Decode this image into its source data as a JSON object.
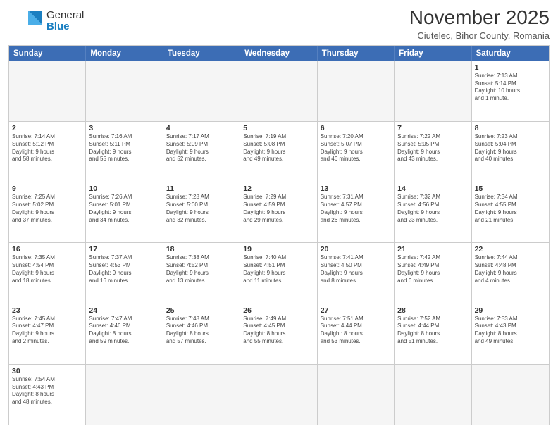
{
  "header": {
    "logo_general": "General",
    "logo_blue": "Blue",
    "month_title": "November 2025",
    "subtitle": "Ciutelec, Bihor County, Romania"
  },
  "day_headers": [
    "Sunday",
    "Monday",
    "Tuesday",
    "Wednesday",
    "Thursday",
    "Friday",
    "Saturday"
  ],
  "rows": [
    [
      {
        "num": "",
        "info": ""
      },
      {
        "num": "",
        "info": ""
      },
      {
        "num": "",
        "info": ""
      },
      {
        "num": "",
        "info": ""
      },
      {
        "num": "",
        "info": ""
      },
      {
        "num": "",
        "info": ""
      },
      {
        "num": "1",
        "info": "Sunrise: 7:13 AM\nSunset: 5:14 PM\nDaylight: 10 hours\nand 1 minute."
      }
    ],
    [
      {
        "num": "2",
        "info": "Sunrise: 7:14 AM\nSunset: 5:12 PM\nDaylight: 9 hours\nand 58 minutes."
      },
      {
        "num": "3",
        "info": "Sunrise: 7:16 AM\nSunset: 5:11 PM\nDaylight: 9 hours\nand 55 minutes."
      },
      {
        "num": "4",
        "info": "Sunrise: 7:17 AM\nSunset: 5:09 PM\nDaylight: 9 hours\nand 52 minutes."
      },
      {
        "num": "5",
        "info": "Sunrise: 7:19 AM\nSunset: 5:08 PM\nDaylight: 9 hours\nand 49 minutes."
      },
      {
        "num": "6",
        "info": "Sunrise: 7:20 AM\nSunset: 5:07 PM\nDaylight: 9 hours\nand 46 minutes."
      },
      {
        "num": "7",
        "info": "Sunrise: 7:22 AM\nSunset: 5:05 PM\nDaylight: 9 hours\nand 43 minutes."
      },
      {
        "num": "8",
        "info": "Sunrise: 7:23 AM\nSunset: 5:04 PM\nDaylight: 9 hours\nand 40 minutes."
      }
    ],
    [
      {
        "num": "9",
        "info": "Sunrise: 7:25 AM\nSunset: 5:02 PM\nDaylight: 9 hours\nand 37 minutes."
      },
      {
        "num": "10",
        "info": "Sunrise: 7:26 AM\nSunset: 5:01 PM\nDaylight: 9 hours\nand 34 minutes."
      },
      {
        "num": "11",
        "info": "Sunrise: 7:28 AM\nSunset: 5:00 PM\nDaylight: 9 hours\nand 32 minutes."
      },
      {
        "num": "12",
        "info": "Sunrise: 7:29 AM\nSunset: 4:59 PM\nDaylight: 9 hours\nand 29 minutes."
      },
      {
        "num": "13",
        "info": "Sunrise: 7:31 AM\nSunset: 4:57 PM\nDaylight: 9 hours\nand 26 minutes."
      },
      {
        "num": "14",
        "info": "Sunrise: 7:32 AM\nSunset: 4:56 PM\nDaylight: 9 hours\nand 23 minutes."
      },
      {
        "num": "15",
        "info": "Sunrise: 7:34 AM\nSunset: 4:55 PM\nDaylight: 9 hours\nand 21 minutes."
      }
    ],
    [
      {
        "num": "16",
        "info": "Sunrise: 7:35 AM\nSunset: 4:54 PM\nDaylight: 9 hours\nand 18 minutes."
      },
      {
        "num": "17",
        "info": "Sunrise: 7:37 AM\nSunset: 4:53 PM\nDaylight: 9 hours\nand 16 minutes."
      },
      {
        "num": "18",
        "info": "Sunrise: 7:38 AM\nSunset: 4:52 PM\nDaylight: 9 hours\nand 13 minutes."
      },
      {
        "num": "19",
        "info": "Sunrise: 7:40 AM\nSunset: 4:51 PM\nDaylight: 9 hours\nand 11 minutes."
      },
      {
        "num": "20",
        "info": "Sunrise: 7:41 AM\nSunset: 4:50 PM\nDaylight: 9 hours\nand 8 minutes."
      },
      {
        "num": "21",
        "info": "Sunrise: 7:42 AM\nSunset: 4:49 PM\nDaylight: 9 hours\nand 6 minutes."
      },
      {
        "num": "22",
        "info": "Sunrise: 7:44 AM\nSunset: 4:48 PM\nDaylight: 9 hours\nand 4 minutes."
      }
    ],
    [
      {
        "num": "23",
        "info": "Sunrise: 7:45 AM\nSunset: 4:47 PM\nDaylight: 9 hours\nand 2 minutes."
      },
      {
        "num": "24",
        "info": "Sunrise: 7:47 AM\nSunset: 4:46 PM\nDaylight: 8 hours\nand 59 minutes."
      },
      {
        "num": "25",
        "info": "Sunrise: 7:48 AM\nSunset: 4:46 PM\nDaylight: 8 hours\nand 57 minutes."
      },
      {
        "num": "26",
        "info": "Sunrise: 7:49 AM\nSunset: 4:45 PM\nDaylight: 8 hours\nand 55 minutes."
      },
      {
        "num": "27",
        "info": "Sunrise: 7:51 AM\nSunset: 4:44 PM\nDaylight: 8 hours\nand 53 minutes."
      },
      {
        "num": "28",
        "info": "Sunrise: 7:52 AM\nSunset: 4:44 PM\nDaylight: 8 hours\nand 51 minutes."
      },
      {
        "num": "29",
        "info": "Sunrise: 7:53 AM\nSunset: 4:43 PM\nDaylight: 8 hours\nand 49 minutes."
      }
    ],
    [
      {
        "num": "30",
        "info": "Sunrise: 7:54 AM\nSunset: 4:43 PM\nDaylight: 8 hours\nand 48 minutes."
      },
      {
        "num": "",
        "info": ""
      },
      {
        "num": "",
        "info": ""
      },
      {
        "num": "",
        "info": ""
      },
      {
        "num": "",
        "info": ""
      },
      {
        "num": "",
        "info": ""
      },
      {
        "num": "",
        "info": ""
      }
    ]
  ]
}
